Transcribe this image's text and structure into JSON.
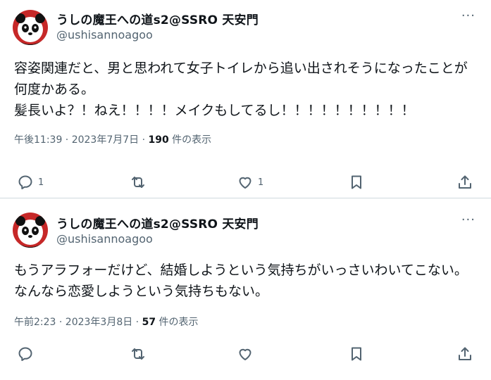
{
  "tweets": [
    {
      "name": "うしの魔王への道s2@SSRO 天安門",
      "handle": "@ushisannoagoo",
      "text": "容姿関連だと、男と思われて女子トイレから追い出されそうになったことが何度かある。\n髪長いよ？！ねえ！！！！メイクもしてるし！！！！！！！！！！",
      "timestamp": "午後11:39 · 2023年7月7日 · ",
      "views": "190",
      "views_suffix": " 件の表示",
      "reply_count": "1",
      "like_count": "1"
    },
    {
      "name": "うしの魔王への道s2@SSRO 天安門",
      "handle": "@ushisannoagoo",
      "text": "もうアラフォーだけど、結婚しようという気持ちがいっさいわいてこない。なんなら恋愛しようという気持ちもない。",
      "timestamp": "午前2:23 · 2023年3月8日 · ",
      "views": "57",
      "views_suffix": " 件の表示"
    }
  ],
  "more_glyph": "···",
  "icons": {
    "avatar": "panda-avatar",
    "reply": "reply-icon",
    "retweet": "retweet-icon",
    "like": "heart-icon",
    "bookmark": "bookmark-icon",
    "share": "share-icon"
  }
}
